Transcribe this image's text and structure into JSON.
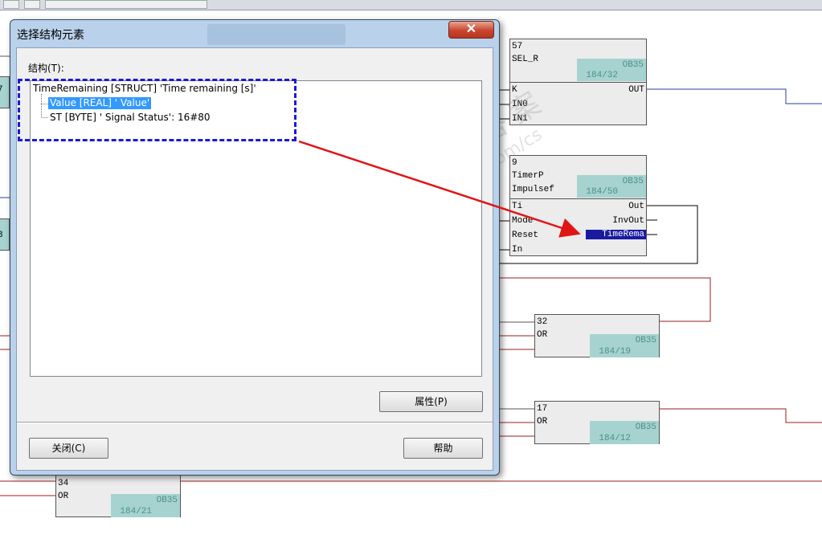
{
  "dialog": {
    "title": "选择结构元素",
    "close_glyph": "✕",
    "structure_label": "结构(T):",
    "tree": {
      "root": "TimeRemaining [STRUCT] 'Time remaining [s]'",
      "children": [
        {
          "label": "Value [REAL] ' Value'",
          "selected": true
        },
        {
          "label": "ST [BYTE] ' Signal Status': 16#80",
          "selected": false
        }
      ]
    },
    "buttons": {
      "properties": "属性(P)",
      "close": "关闭(C)",
      "help": "帮助"
    }
  },
  "diagram": {
    "blocks": [
      {
        "id": "57",
        "type": "SEL_R",
        "ob": "OB35",
        "pos": "184/32",
        "inputs": [
          "K",
          "IN0",
          "IN1"
        ],
        "outputs": [
          "OUT"
        ]
      },
      {
        "id": "9",
        "type": "TimerP",
        "subtitle": "Impulsef",
        "ob": "OB35",
        "pos": "184/50",
        "inputs": [
          "Ti",
          "Mode",
          "Reset",
          "In"
        ],
        "outputs": [
          "Out",
          "InvOut",
          "TimeRema"
        ]
      },
      {
        "id": "32",
        "type": "OR",
        "ob": "OB35",
        "pos": "184/19"
      },
      {
        "id": "17",
        "type": "OR",
        "ob": "OB35",
        "pos": "184/12"
      },
      {
        "id": "34",
        "type": "OR",
        "ob": "OB35",
        "pos": "184/21"
      }
    ],
    "left_edge_fragments": [
      "7",
      "8"
    ]
  },
  "watermark": {
    "line1": "西门子工业  找答案",
    "line2": "support.industry.siemens.com/cs"
  },
  "colors": {
    "annotation_box": "#1a1ad6",
    "annotation_arrow": "#e01515",
    "selection": "#3399ff",
    "highlight_pin": "#1a1aa0",
    "ob_badge": "#a6d3cf"
  }
}
